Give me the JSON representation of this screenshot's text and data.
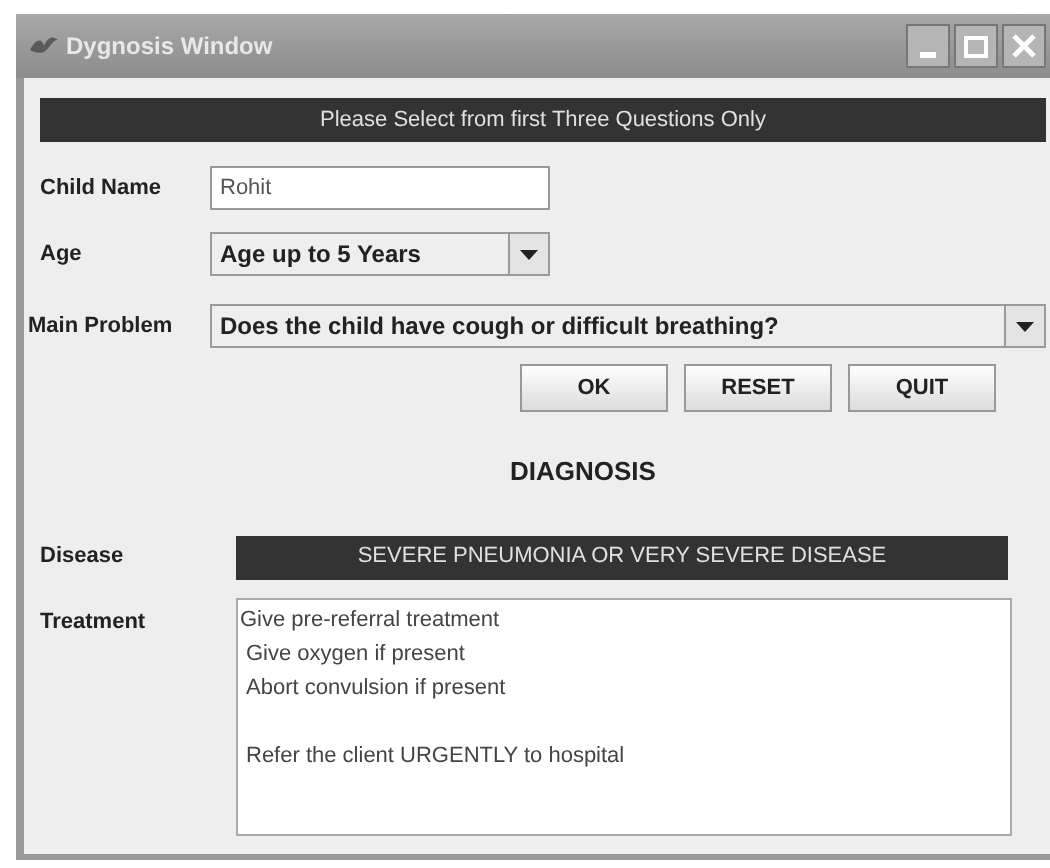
{
  "window": {
    "title": "Dygnosis Window"
  },
  "notice": "Please Select from first Three Questions Only",
  "form": {
    "child_name": {
      "label": "Child Name",
      "value": "Rohit"
    },
    "age": {
      "label": "Age",
      "value": "Age up to 5 Years"
    },
    "main_problem": {
      "label": "Main Problem",
      "value": "Does the child have cough or difficult breathing?"
    }
  },
  "buttons": [
    "OK",
    "RESET",
    "QUIT"
  ],
  "diagnosis": {
    "heading": "DIAGNOSIS",
    "disease_label": "Disease",
    "disease": "SEVERE PNEUMONIA OR VERY SEVERE DISEASE",
    "treatment_label": "Treatment",
    "treatment": [
      [
        "Give pre-referral treatment",
        "Give oxygen if present",
        "Abort convulsion if present"
      ],
      [
        "Refer the client URGENTLY to hospital"
      ]
    ]
  }
}
